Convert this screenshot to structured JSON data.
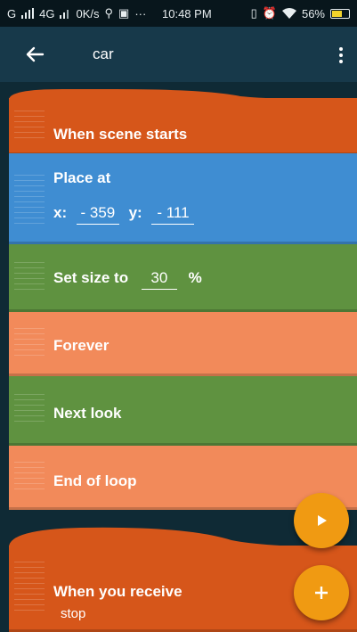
{
  "status_bar": {
    "carrier_signal": "G",
    "network": "4G",
    "data_rate": "0K/s",
    "more_indicator": "···",
    "time": "10:48 PM",
    "battery": "56%",
    "battery_level": 0.56
  },
  "appbar": {
    "back_icon": "arrow-left-icon",
    "title": "car",
    "menu_icon": "more-vert-icon"
  },
  "colors": {
    "event_orange": "#d6561a",
    "motion_blue": "#3f8dd2",
    "looks_green": "#5f9240",
    "control_salmon": "#f28a5a",
    "fab_orange": "#f09a12",
    "background": "#0f2a35"
  },
  "bricks": {
    "when_scene_starts": "When scene starts",
    "place_at": {
      "label": "Place at",
      "x_label": "x:",
      "x_value": "- 359",
      "y_label": "y:",
      "y_value": "- 111"
    },
    "set_size": {
      "label": "Set size to",
      "value": "30",
      "unit": "%"
    },
    "forever": "Forever",
    "next_look": "Next look",
    "end_of_loop": "End of loop",
    "when_you_receive": {
      "label": "When you receive",
      "message": "stop"
    }
  },
  "fab": {
    "play_icon": "play-icon",
    "add_icon": "plus-icon"
  }
}
